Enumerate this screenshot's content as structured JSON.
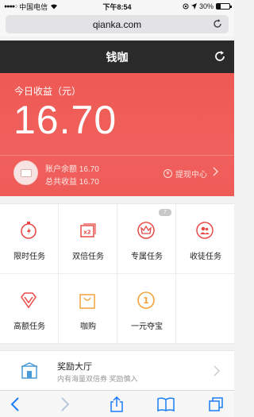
{
  "statusbar": {
    "carrier": "中国电信",
    "time": "下午8:54",
    "battery": "30%",
    "battery_level": 0.3
  },
  "browser": {
    "url": "qianka.com"
  },
  "navbar": {
    "title": "钱咖"
  },
  "earnings": {
    "today_label": "今日收益（元）",
    "today_value": "16.70",
    "balance_line": "账户余额 16.70",
    "total_line": "总共收益 16.70",
    "withdraw_label": "提现中心"
  },
  "tasks": [
    {
      "label": "限时任务",
      "icon": "stopwatch-icon"
    },
    {
      "label": "双倍任务",
      "icon": "double-x2-icon"
    },
    {
      "label": "专属任务",
      "icon": "crown-icon",
      "badge": "7"
    },
    {
      "label": "收徒任务",
      "icon": "people-icon"
    },
    {
      "label": "高额任务",
      "icon": "diamond-icon"
    },
    {
      "label": "咖购",
      "icon": "shopping-bag-icon"
    },
    {
      "label": "一元夺宝",
      "icon": "treasure-coin-icon"
    }
  ],
  "reward_hall": {
    "title": "奖励大厅",
    "subtitle": "内有海量双倍券 奖励慎入"
  },
  "colors": {
    "accent": "#ee5a55",
    "navbar": "#2a2a2a",
    "task_red": "#e84b47",
    "task_orange": "#f4a33c"
  }
}
